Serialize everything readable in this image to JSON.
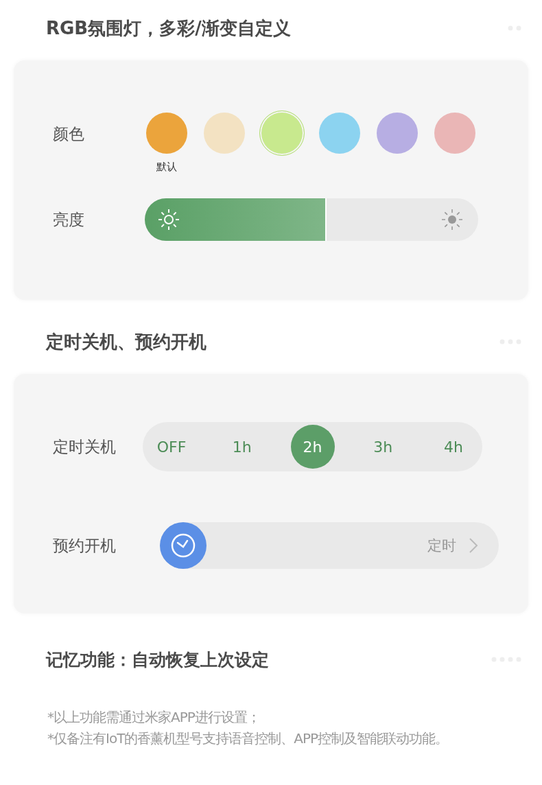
{
  "light_section": {
    "heading": "RGB氛围灯，多彩/渐变自定义",
    "color_label": "颜色",
    "swatches": [
      {
        "color": "#eba43c",
        "selected": false,
        "caption": "默认"
      },
      {
        "color": "#f3e2c2",
        "selected": false
      },
      {
        "color": "#c8e98e",
        "selected": true
      },
      {
        "color": "#8cd3f0",
        "selected": false
      },
      {
        "color": "#b7aee3",
        "selected": false
      },
      {
        "color": "#eab6b6",
        "selected": false
      }
    ],
    "brightness_label": "亮度",
    "brightness": {
      "level": 0.545
    }
  },
  "timer_section": {
    "heading": "定时关机、预约开机",
    "shutdown_label": "定时关机",
    "shutdown_options": [
      {
        "label": "OFF",
        "selected": false
      },
      {
        "label": "1h",
        "selected": false
      },
      {
        "label": "2h",
        "selected": true
      },
      {
        "label": "3h",
        "selected": false
      },
      {
        "label": "4h",
        "selected": false
      }
    ],
    "schedule_label": "预约开机",
    "schedule_value": "定时"
  },
  "memory_section": {
    "heading": "记忆功能：自动恢复上次设定"
  },
  "notes": [
    "*以上功能需通过米家APP进行设置；",
    "*仅备注有IoT的香薰机型号支持语音控制、APP控制及智能联动功能。"
  ]
}
